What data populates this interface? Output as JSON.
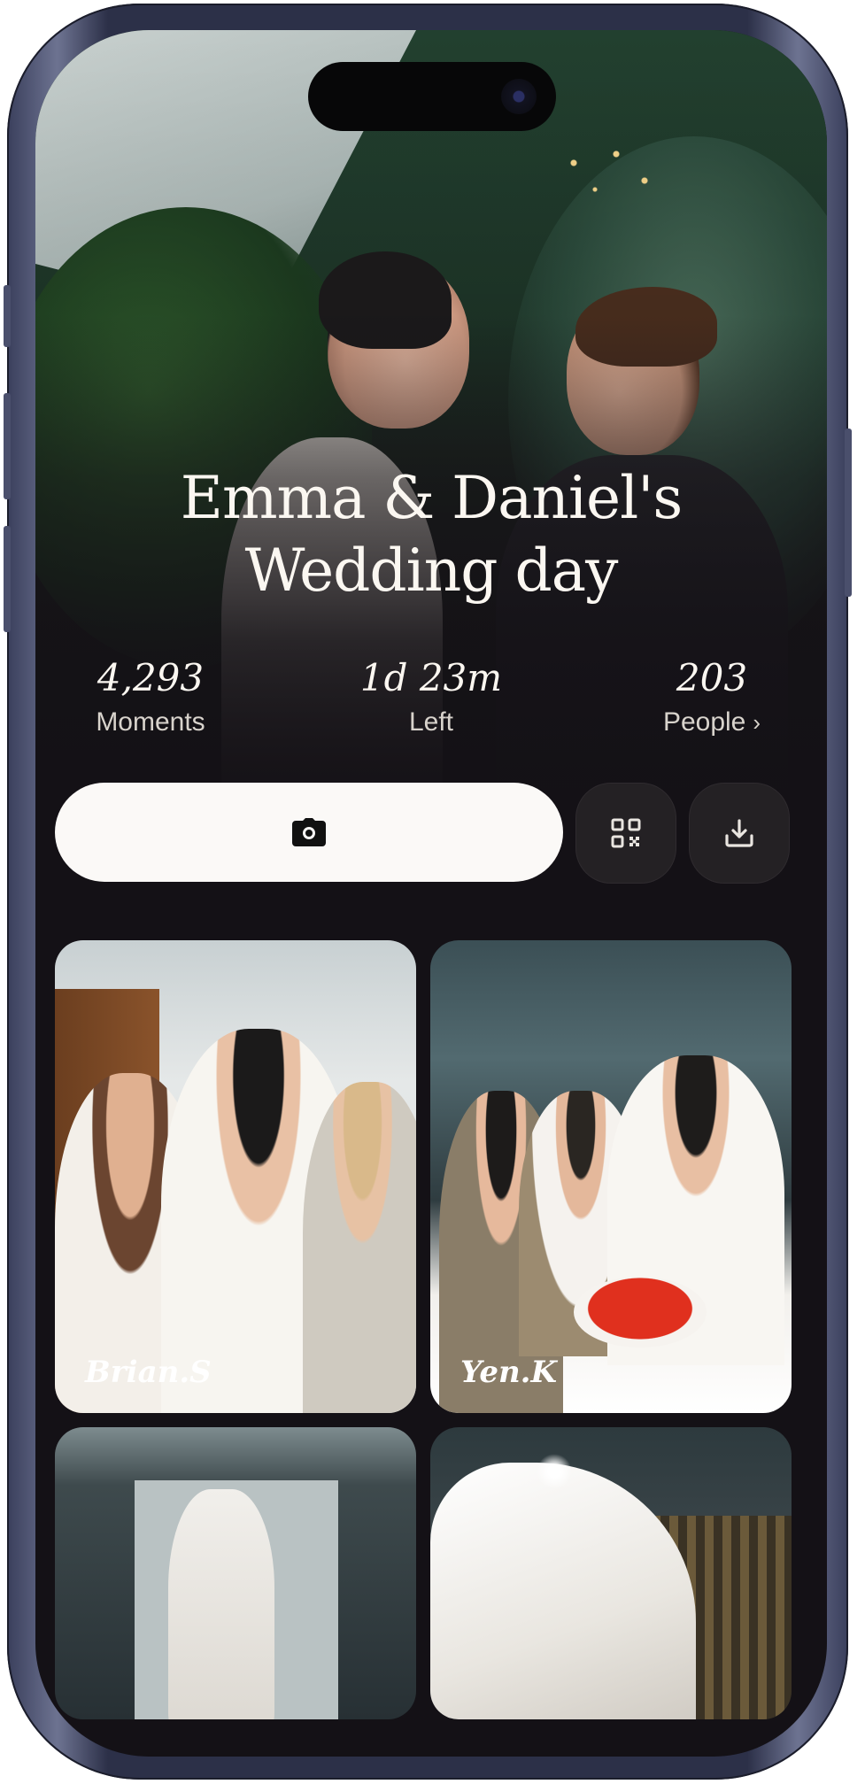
{
  "event": {
    "title_line1": "Emma & Daniel's",
    "title_line2": "Wedding day"
  },
  "stats": {
    "moments": {
      "value": "4,293",
      "label": "Moments"
    },
    "time_left": {
      "value": "1d 23m",
      "label": "Left"
    },
    "people": {
      "value": "203",
      "label": "People",
      "chevron": "›"
    }
  },
  "actions": {
    "capture_icon": "camera-icon",
    "qr_icon": "qr-code-icon",
    "download_icon": "download-icon"
  },
  "gallery": [
    {
      "caption": "Brian.S"
    },
    {
      "caption": "Yen.K"
    },
    {
      "caption": ""
    },
    {
      "caption": ""
    }
  ],
  "colors": {
    "background": "#141116",
    "primary_button": "#fbf9f7",
    "secondary_button": "#242124",
    "text": "#fbf7f1"
  }
}
